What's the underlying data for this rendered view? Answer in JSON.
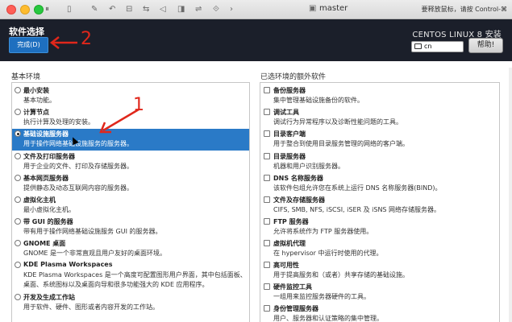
{
  "titlebar": {
    "window_title": "master",
    "hint": "要释放鼠标，请按 Control-⌘",
    "traffic_lights": [
      "#ff5f57",
      "#febc2e",
      "#28c840"
    ]
  },
  "header": {
    "page_title": "软件选择",
    "done_label": "完成(D)",
    "product": "CENTOS LINUX 8 安装",
    "keyboard_layout": "cn",
    "help_label": "帮助!"
  },
  "left": {
    "title": "基本环境",
    "items": [
      {
        "name": "最小安装",
        "desc": "基本功能。"
      },
      {
        "name": "计算节点",
        "desc": "执行计算及处理的安装。"
      },
      {
        "name": "基础设施服务器",
        "desc": "用于操作网络基础设施服务的服务器。"
      },
      {
        "name": "文件及打印服务器",
        "desc": "用于企业的文件、打印及存储服务器。"
      },
      {
        "name": "基本网页服务器",
        "desc": "提供静态及动态互联网内容的服务器。"
      },
      {
        "name": "虚拟化主机",
        "desc": "最小虚拟化主机。"
      },
      {
        "name": "带 GUI 的服务器",
        "desc": "带有用于操作网络基础设施服务 GUI 的服务器。"
      },
      {
        "name": "GNOME 桌面",
        "desc": "GNOME 是一个非常直观且用户友好的桌面环境。"
      },
      {
        "name": "KDE Plasma Workspaces",
        "desc": "KDE Plasma Workspaces 是一个高度可配置图形用户界面，其中包括面板、桌面、系统图标以及桌面向导和很多功能强大的 KDE 应用程序。"
      },
      {
        "name": "开发及生成工作站",
        "desc": "用于软件、硬件、图形或者内容开发的工作站。"
      }
    ],
    "selected_index": 2
  },
  "right": {
    "title": "已选环境的额外软件",
    "items": [
      {
        "name": "备份服务器",
        "desc": "集中管理基础设施备份的软件。"
      },
      {
        "name": "调试工具",
        "desc": "调试行为异常程序以及诊断性能问题的工具。"
      },
      {
        "name": "目录客户端",
        "desc": "用于整合到使用目录服务管理的网络的客户端。"
      },
      {
        "name": "目录服务器",
        "desc": "机器和用户识别服务器。"
      },
      {
        "name": "DNS 名称服务器",
        "desc": "该软件包组允许您在系统上运行 DNS 名称服务器(BIND)。"
      },
      {
        "name": "文件及存储服务器",
        "desc": "CIFS, SMB, NFS, iSCSI, iSER 及 iSNS 网络存储服务器。"
      },
      {
        "name": "FTP 服务器",
        "desc": "允许将系统作为 FTP 服务器使用。"
      },
      {
        "name": "虚拟机代理",
        "desc": "在 hypervisor 中运行时使用的代理。"
      },
      {
        "name": "高可用性",
        "desc": "用于提高服务和（或者）共享存储的基础设施。"
      },
      {
        "name": "硬件监控工具",
        "desc": "一组用来监控服务器硬件的工具。"
      },
      {
        "name": "身份管理服务器",
        "desc": "用户、服务器和认证策略的集中管理。"
      }
    ]
  },
  "annotations": {
    "label_1": "1",
    "label_2": "2",
    "color": "#e0271b"
  }
}
